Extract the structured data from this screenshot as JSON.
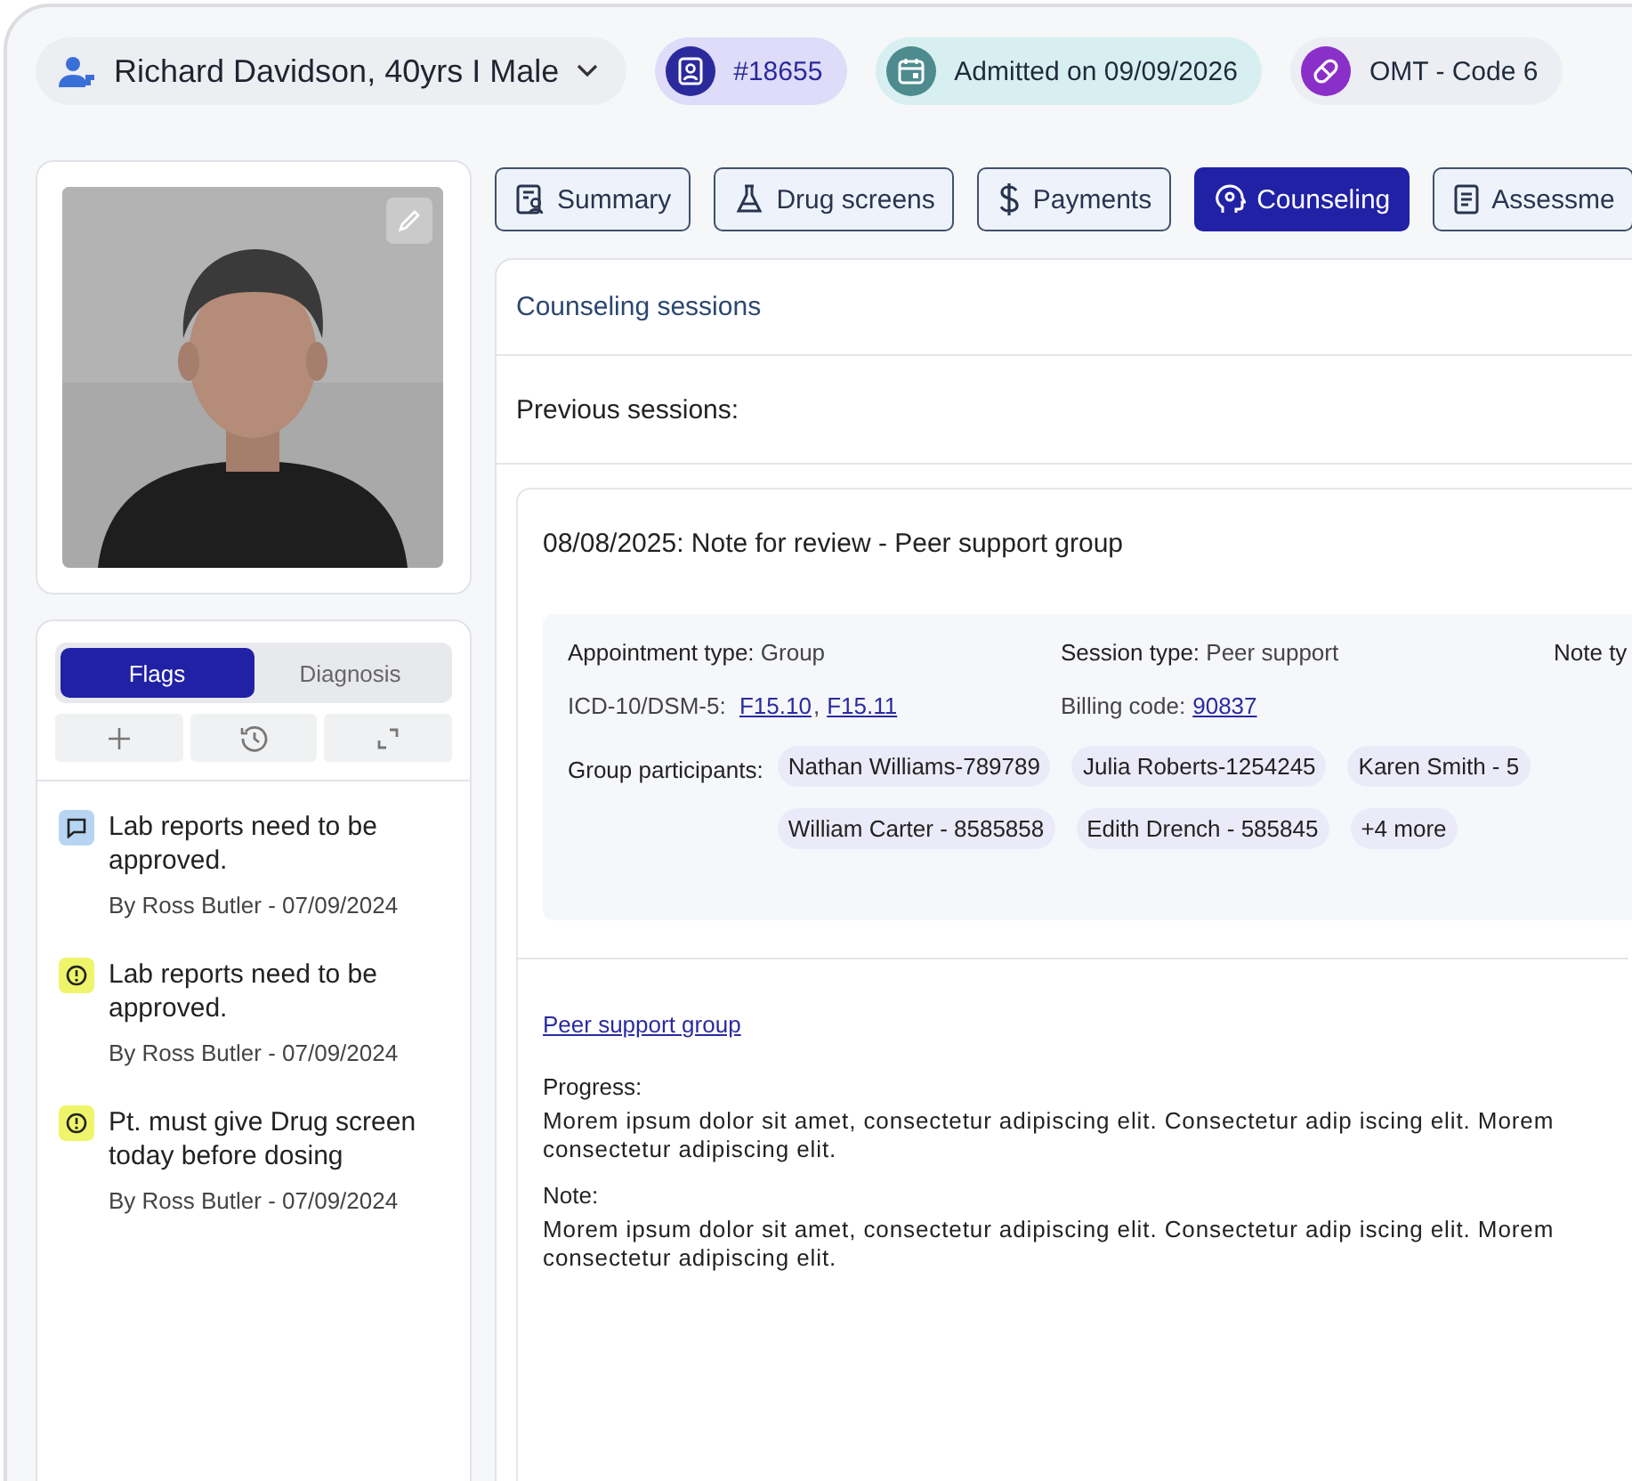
{
  "patient": {
    "name": "Richard Davidson, 40yrs I Male"
  },
  "chips": [
    {
      "kind": "id",
      "label": "#18655"
    },
    {
      "kind": "admitted",
      "label": "Admitted on 09/09/2026"
    },
    {
      "kind": "medication",
      "label": "OMT - Code 6"
    }
  ],
  "side_tabs": [
    {
      "label": "Flags",
      "selected": true
    },
    {
      "label": "Diagnosis",
      "selected": false
    }
  ],
  "flags": [
    {
      "kind": "comment",
      "text": "Lab reports need to be approved.",
      "author": "By Ross Butler - 07/09/2024"
    },
    {
      "kind": "alert",
      "text": "Lab reports need to be approved.",
      "author": "By Ross Butler - 07/09/2024"
    },
    {
      "kind": "alert",
      "text": "Pt. must give Drug screen today before dosing",
      "author": "By Ross Butler - 07/09/2024"
    }
  ],
  "tabs": [
    {
      "kind": "summary",
      "label": "Summary",
      "selected": false
    },
    {
      "kind": "drug",
      "label": "Drug screens",
      "selected": false
    },
    {
      "kind": "payments",
      "label": "Payments",
      "selected": false
    },
    {
      "kind": "counseling",
      "label": "Counseling",
      "selected": true
    },
    {
      "kind": "assessment",
      "label": "Assessme",
      "selected": false
    }
  ],
  "counseling": {
    "title": "Counseling sessions",
    "previous_label": "Previous sessions:",
    "session": {
      "heading": "08/08/2025: Note for review - Peer support group",
      "appointment_type": {
        "label": "Appointment type:",
        "value": "Group"
      },
      "session_type": {
        "label": "Session type:",
        "value": "Peer support"
      },
      "note_type": {
        "label": "Note ty"
      },
      "icd": {
        "label": "ICD-10/DSM-5:",
        "codes": [
          "F15.10",
          "F15.11"
        ],
        "separator": ","
      },
      "billing": {
        "label": "Billing code:",
        "code": "90837"
      },
      "participants": {
        "label": "Group participants:",
        "names": [
          "Nathan Williams-789789",
          "Julia Roberts-1254245",
          "Karen Smith - 5",
          "William Carter - 8585858",
          "Edith Drench - 585845"
        ],
        "more": "+4 more"
      },
      "group_link": "Peer support group",
      "progress": {
        "label": "Progress:",
        "text": "Morem ipsum dolor sit amet, consectetur adipiscing elit. Consectetur adip iscing elit. Morem consectetur  adipiscing elit."
      },
      "note": {
        "label": "Note:",
        "text": "Morem ipsum dolor sit amet, consectetur adipiscing elit. Consectetur adip iscing elit. Morem consectetur  adipiscing elit."
      }
    }
  }
}
